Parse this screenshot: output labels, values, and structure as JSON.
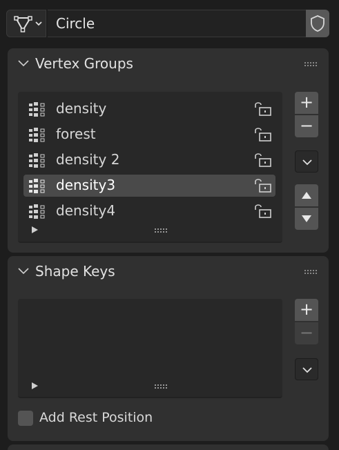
{
  "object": {
    "name": "Circle",
    "type_icon": "mesh-data-icon",
    "fake_user_icon": "shield-icon"
  },
  "vertex_groups": {
    "title": "Vertex Groups",
    "items": [
      {
        "label": "density",
        "selected": false
      },
      {
        "label": "forest",
        "selected": false
      },
      {
        "label": "density 2",
        "selected": false
      },
      {
        "label": "density3",
        "selected": true
      },
      {
        "label": "density4",
        "selected": false
      }
    ],
    "buttons": {
      "add": "+",
      "remove": "−"
    }
  },
  "shape_keys": {
    "title": "Shape Keys",
    "buttons": {
      "add": "+",
      "remove": "−"
    },
    "add_rest_position_label": "Add Rest Position",
    "add_rest_position_checked": false
  },
  "colors": {
    "background": "#1d1d1d",
    "panel": "#303030",
    "list": "#282828",
    "selected_row": "#4a4a4a",
    "button": "#545454"
  }
}
